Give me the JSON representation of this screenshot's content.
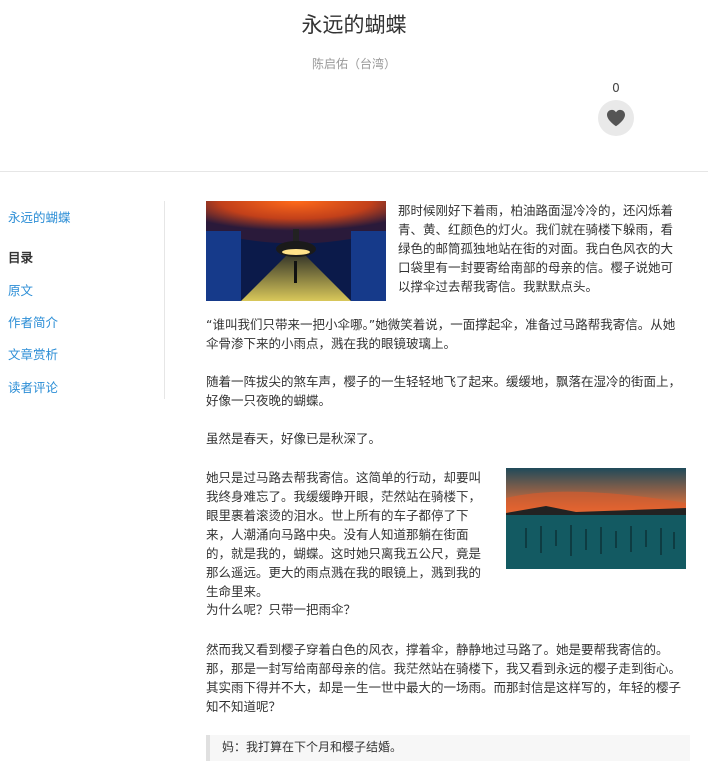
{
  "header": {
    "title": "永远的蝴蝶",
    "author": "陈启佑（台湾）",
    "like_count": "0"
  },
  "sidebar": {
    "current": "永远的蝴蝶",
    "toc_heading": "目录",
    "items": [
      "原文",
      "作者简介",
      "文章赏析",
      "读者评论"
    ]
  },
  "article": {
    "paragraphs": [
      "那时候刚好下着雨，柏油路面湿冷冷的，还闪烁着青、黄、红颜色的灯火。我们就在骑楼下躲雨，看绿色的邮筒孤独地站在街的对面。我白色风衣的大口袋里有一封要寄给南部的母亲的信。樱子说她可以撑伞过去帮我寄信。我默默点头。",
      "“谁叫我们只带来一把小伞哪。”她微笑着说，一面撑起伞，准备过马路帮我寄信。从她伞骨渗下来的小雨点，溅在我的眼镜玻璃上。",
      "随着一阵拔尖的煞车声，樱子的一生轻轻地飞了起来。缓缓地，飘落在湿冷的街面上，好像一只夜晚的蝴蝶。",
      "虽然是春天，好像已是秋深了。",
      "她只是过马路去帮我寄信。这简单的行动，却要叫我终身难忘了。我缓缓睁开眼，茫然站在骑楼下，眼里裹着滚烫的泪水。世上所有的车子都停了下来，人潮涌向马路中央。没有人知道那躺在街面的，就是我的，蝴蝶。这时她只离我五公尺，竟是那么遥远。更大的雨点溅在我的眼镜上，溅到我的生命里来。",
      "为什么呢？只带一把雨伞？",
      "然而我又看到樱子穿着白色的风衣，撑着伞，静静地过马路了。她是要帮我寄信的。那，那是一封写给南部母亲的信。我茫然站在骑楼下，我又看到永远的樱子走到街心。其实雨下得并不大，却是一生一世中最大的一场雨。而那封信是这样写的，年轻的樱子知不知道呢？"
    ],
    "quote": "妈：我打算在下个月和樱子结婚。"
  },
  "colors": {
    "link": "#2c8ed6",
    "text": "#333333",
    "muted": "#999999"
  }
}
